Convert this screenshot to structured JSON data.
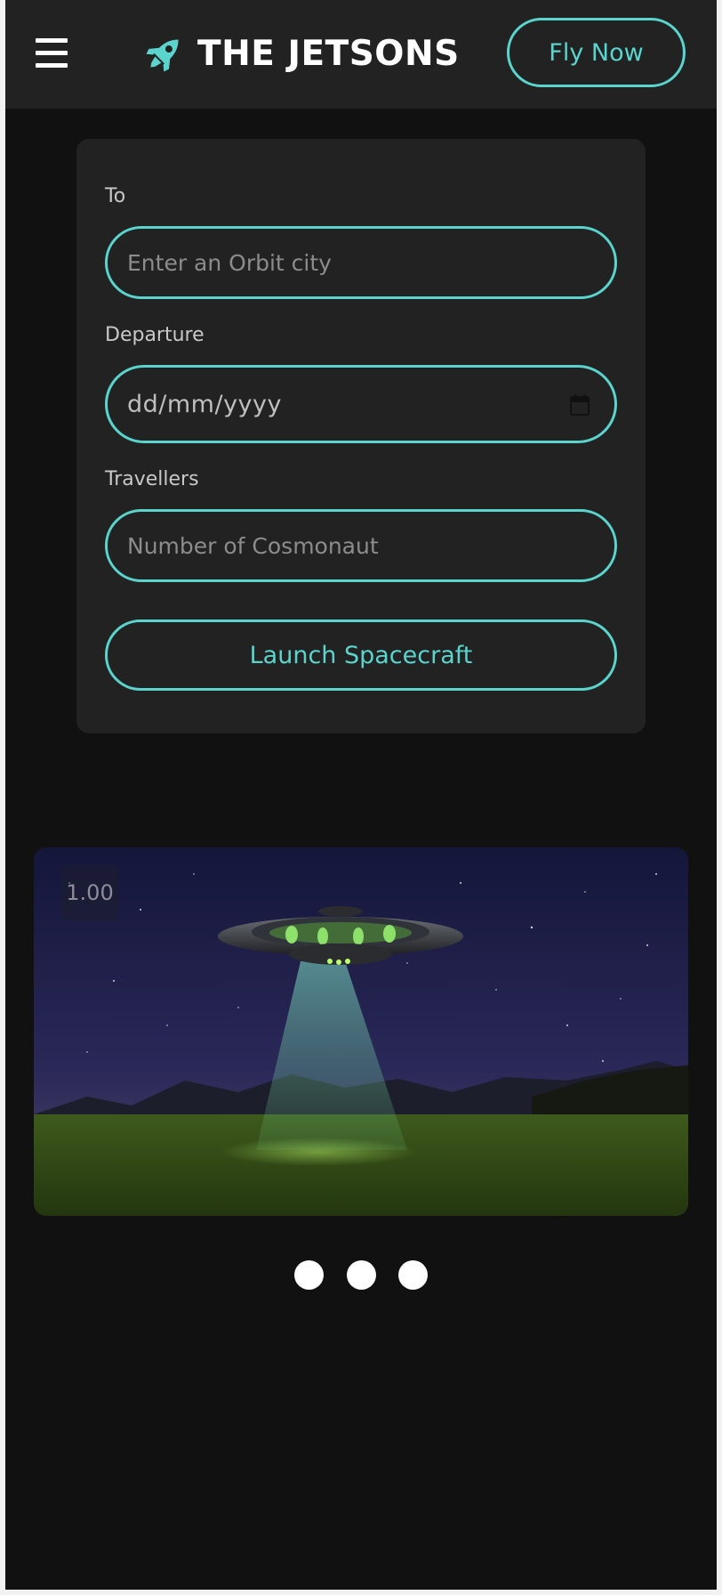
{
  "header": {
    "brand_name": "THE JETSONS",
    "fly_now_label": "Fly Now",
    "accent_color": "#5ad4cc"
  },
  "booking_form": {
    "to_label": "To",
    "to_placeholder": "Enter an Orbit city",
    "departure_label": "Departure",
    "departure_value": "dd/mm/yyyy",
    "travellers_label": "Travellers",
    "travellers_placeholder": "Number of Cosmonaut",
    "submit_label": "Launch Spacecraft"
  },
  "carousel": {
    "badge": "1.00",
    "slide_count": 3,
    "image_subject": "UFO over a grassy field at night"
  },
  "icons": {
    "menu": "hamburger-menu-icon",
    "brand": "rocket-icon",
    "date": "calendar-icon"
  }
}
